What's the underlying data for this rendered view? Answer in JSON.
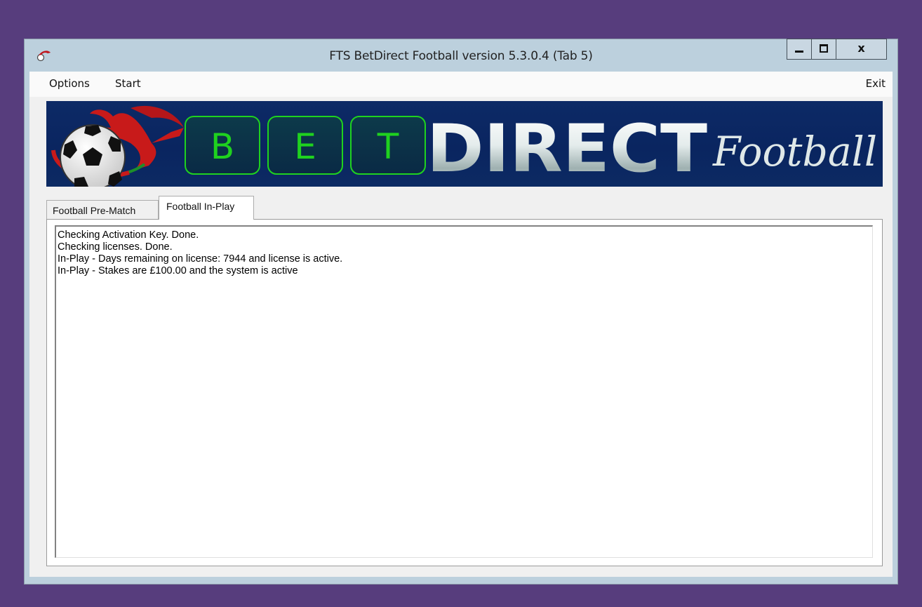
{
  "window": {
    "title": "FTS BetDirect Football  version 5.3.0.4 (Tab 5)",
    "close_glyph": "x"
  },
  "menu": {
    "options": "Options",
    "start": "Start",
    "exit": "Exit"
  },
  "banner": {
    "letters": [
      "B",
      "E",
      "T"
    ],
    "word": "DIRECT",
    "script": "Football"
  },
  "tabs": [
    {
      "label": "Football Pre-Match",
      "active": false
    },
    {
      "label": "Football In-Play",
      "active": true
    }
  ],
  "log": {
    "lines": [
      "Checking Activation Key. Done.",
      "Checking licenses. Done.",
      "In-Play - Days remaining on license: 7944 and license is active.",
      "In-Play - Stakes are £100.00 and the system is active"
    ]
  },
  "colors": {
    "desktop": "#573d7d",
    "banner_bg": "#0a2560",
    "letter_green": "#1fd21f"
  }
}
